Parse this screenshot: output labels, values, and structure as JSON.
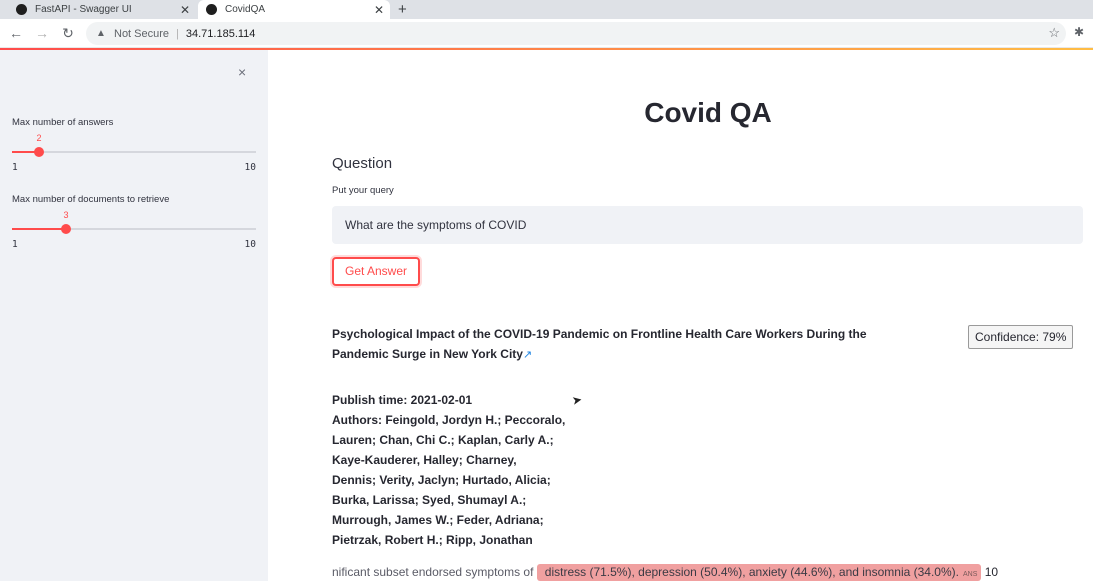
{
  "browser": {
    "tabs": [
      {
        "title": "FastAPI - Swagger UI",
        "active": false
      },
      {
        "title": "CovidQA",
        "active": true
      }
    ],
    "new_tab": "+",
    "security_label": "Not Secure",
    "url": "34.71.185.114"
  },
  "sidebar": {
    "close": "×",
    "max_answers": {
      "label": "Max number of answers",
      "value": "2",
      "min": "1",
      "max": "10"
    },
    "max_documents": {
      "label": "Max number of documents to retrieve",
      "value": "3",
      "min": "1",
      "max": "10"
    }
  },
  "main": {
    "title": "Covid QA",
    "section_title": "Question",
    "input_label": "Put your query",
    "query_value": "What are the symptoms of COVID",
    "button_label": "Get Answer",
    "result": {
      "title": "Psychological Impact of the COVID-19 Pandemic on Frontline Health Care Workers During the Pandemic Surge in New York City",
      "confidence": "Confidence: 79%",
      "publish_time": "Publish time: 2021-02-01",
      "authors_lines": [
        "Authors: Feingold, Jordyn H.; Peccoralo,",
        "Lauren; Chan, Chi C.; Kaplan, Carly A.;",
        "Kaye-Kauderer, Halley; Charney,",
        "Dennis; Verity, Jaclyn; Hurtado, Alicia;",
        "Burka, Larissa; Syed, Shumayl A.;",
        "Murrough, James W.; Feder, Adriana;",
        "Pietrzak, Robert H.; Ripp, Jonathan"
      ],
      "snippet_before": "nificant subset endorsed symptoms of",
      "answer": "distress (71.5%), depression (50.4%), anxiety (44.6%), and insomnia (34.0%).",
      "answer_tag": "ANS",
      "snippet_after": "10"
    }
  },
  "colors": {
    "accent": "#ff4b4b",
    "sidebar_bg": "#f0f2f6",
    "highlight": "#f0a0a0"
  }
}
